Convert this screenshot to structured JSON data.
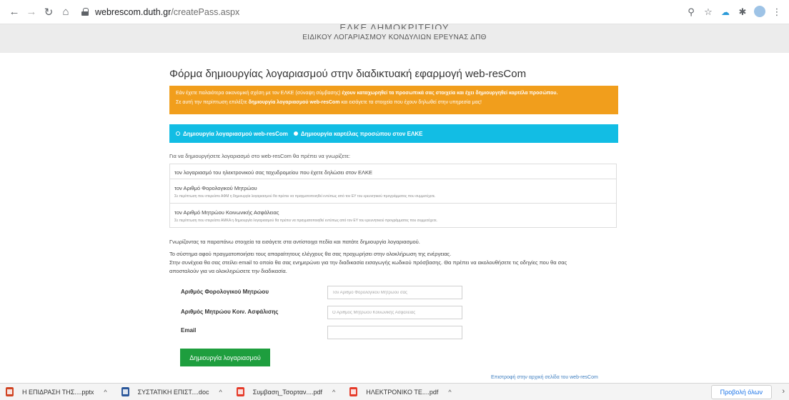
{
  "browser": {
    "url_host": "webrescom.duth.gr",
    "url_path": "/createPass.aspx"
  },
  "header": {
    "top_clipped": "ΕΛΚΕ ΔΗΜΟΚΡΙΤΕΙΟΥ",
    "subtitle": "ΕΙΔΙΚΟΥ ΛΟΓΑΡΙΑΣΜΟΥ ΚΟΝΔΥΛΙΩΝ ΕΡΕΥΝΑΣ ΔΠΘ"
  },
  "form_page": {
    "title": "Φόρμα δημιουργίας λογαριασμού στην διαδικτυακή εφαρμογή web-resCom",
    "alert_line1_prefix": "Εάν έχετε παλαιότερα οικονομική σχέση με τον ΕΛΚΕ (σύναψη σύμβασης) ",
    "alert_line1_bold": "έχουν καταχωρηθεί τα προσωπικά σας στοιχεία και έχει δημιουργηθεί καρτέλα προσώπου.",
    "alert_line2_prefix": "Σε αυτή την περίπτωση επιλέξτε ",
    "alert_line2_bold": "δημιουργία λογαριασμού web-resCom",
    "alert_line2_suffix": " και εισάγετε τα στοιχεία που έχουν δηλωθεί στην υπηρεσία μας!",
    "tab1_label": "Δημιουργία λογαριασμού web-resCom",
    "tab2_label": "Δημιουργία καρτέλας προσώπου στον ΕΛΚΕ",
    "intro": "Για να δημιουργήσετε λογαριασμό στο web-resCom θα πρέπει να γνωρίζετε:",
    "requirements": [
      {
        "title": "τον λογαριασμό του ηλεκτρονικού σας ταχυδρομείου που έχετε δηλώσει στον ΕΛΚΕ",
        "note": ""
      },
      {
        "title": "τον Αριθμό Φορολογικού Μητρώου",
        "note": "Σε περίπτωση που στερείστε ΑΦΜ η δημιουργία λογαριασμού θα πρέπει να πραγματοποιηθεί εντύπως από τον ΕΥ του ερευνητικού προγράμματος που συμμετέχετε."
      },
      {
        "title": "τον Αριθμό Μητρώου Κοινωνικής Ασφάλειας",
        "note": "Σε περίπτωση που στερείστε ΑΜΚΑ η δημιουργία λογαριασμού θα πρέπει να πραγματοποιηθεί εντύπως από τον ΕΥ του ερευνητικού προγράμματος που συμμετέχετε."
      }
    ],
    "fill_instruction": "Γνωρίζοντας τα παραπάνω στοιχεία τα εισάγετε στα αντίστοιχα πεδία και πατάτε δημιουργία λογαριασμού.",
    "info_line1": "Το σύστημα αφού πραγματοποιήσει τους απαραίτητους ελέγχους θα σας προχωρήσει στην ολοκλήρωση της ενέργειας.",
    "info_line2": "Στην συνέχεια θα σας στείλει email το οποίο θα σας ενημερώνει για την διαδικασία εισαγωγής κωδικού πρόσβασης. Θα πρέπει να ακολουθήσετε τις οδηγίες που θα σας",
    "info_line3": "αποσταλούν για να ολοκληρώσετε την διαδικασία."
  },
  "fields": {
    "afm_label": "Αριθμός Φορολογικού Μητρώου",
    "afm_placeholder": "Τον Αριθμό Φορολογικού Μητρώου σας",
    "amka_label": "Αριθμός Μητρώου Κοιν. Ασφάλισης",
    "amka_placeholder": "Ο Αριθμός Μητρώου Κοινωνικής Ασφάλειας",
    "email_label": "Email",
    "email_placeholder": "",
    "submit_label": "Δημιουργία λογαριασμού",
    "back_link": "Επιστροφή στην αρχική σελίδα του web-resCom"
  },
  "downloads": {
    "items": [
      {
        "name": "Η ΕΠΙΔΡΑΣΗ ΤΗΣ....pptx",
        "type": "pptx"
      },
      {
        "name": "ΣΥΣΤΑΤΙΚΗ ΕΠΙΣΤ....doc",
        "type": "doc"
      },
      {
        "name": "Συμβαση_Τσορταν....pdf",
        "type": "pdf"
      },
      {
        "name": "ΗΛΕΚΤΡΟΝΙΚΟ ΤΕ....pdf",
        "type": "pdf"
      }
    ],
    "show_all": "Προβολή όλων"
  },
  "colors": {
    "alert_orange": "#f19e1c",
    "tab_cyan": "#12bde4",
    "submit_green": "#1e9e3e",
    "header_gray": "#ececec"
  },
  "icons": {
    "back": "back-arrow-icon",
    "forward": "forward-arrow-icon",
    "reload": "reload-icon",
    "home": "home-icon",
    "lock": "lock-icon",
    "zoom": "zoom-icon",
    "star": "star-icon",
    "extension": "extension-icon",
    "menu": "menu-icon"
  }
}
